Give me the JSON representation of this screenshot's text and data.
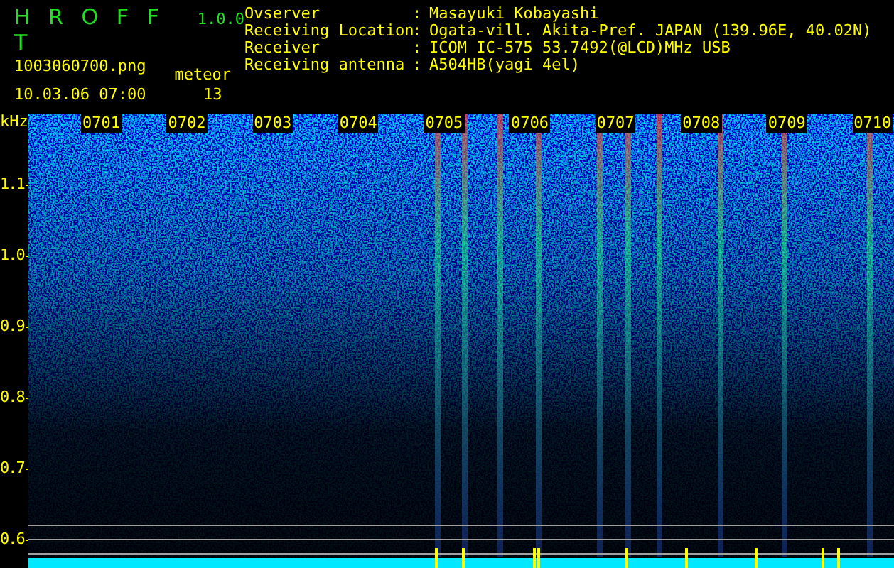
{
  "app": {
    "title": "H R O F F T",
    "version": "1.0.0",
    "file": "1003060700.png",
    "datetime": "10.03.06 07:00",
    "counter_label": "meteor",
    "counter_value": "13"
  },
  "station": [
    {
      "label": "Ovserver",
      "separator": ":",
      "value": "Masayuki Kobayashi"
    },
    {
      "label": "Receiving Location",
      "separator": ":",
      "value": "Ogata-vill. Akita-Pref. JAPAN (139.96E, 40.02N)"
    },
    {
      "label": "Receiver",
      "separator": ":",
      "value": "ICOM IC-575 53.7492(@LCD)MHz USB"
    },
    {
      "label": "Receiving antenna",
      "separator": ":",
      "value": "A504HB(yagi 4el)"
    }
  ],
  "spectrogram": {
    "unit": "kHz",
    "time_labels": [
      "0701",
      "0702",
      "0703",
      "0704",
      "0705",
      "0706",
      "0707",
      "0708",
      "0709",
      "0710"
    ],
    "freq_labels": [
      "1.1",
      "1.0",
      "0.9",
      "0.8",
      "0.7",
      "0.6"
    ]
  }
}
